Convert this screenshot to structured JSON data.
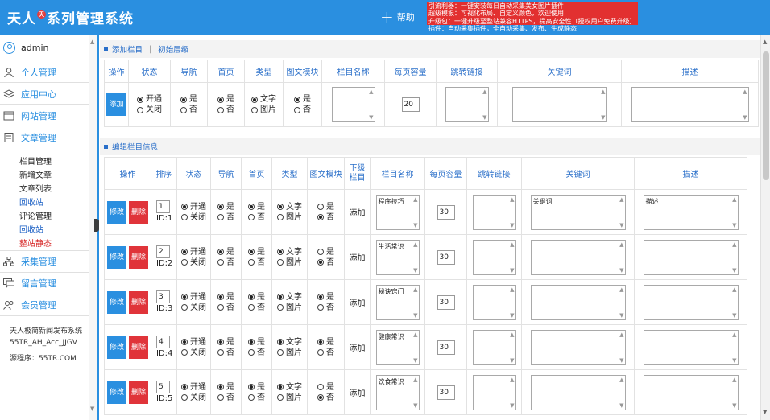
{
  "header": {
    "logo_a": "天人",
    "logo_mark": "天",
    "logo_b": "系列管理系统",
    "help_label": "帮助",
    "notices": [
      "引流利器：一键安装每日自动采集美女图片插件",
      "超级模板：可视化布局、自定义颜色，欢迎使用",
      "升级包：一键升级至整站兼容HTTPS，提高安全性（授权用户免费升级）",
      "插件：自动采集插件，全自动采集、发布、生成静态"
    ]
  },
  "sidebar": {
    "user": "admin",
    "menus": [
      {
        "label": "个人管理",
        "icon": "person-icon"
      },
      {
        "label": "应用中心",
        "icon": "layers-icon"
      },
      {
        "label": "网站管理",
        "icon": "website-icon"
      },
      {
        "label": "文章管理",
        "icon": "document-icon"
      }
    ],
    "subitems": [
      {
        "label": "栏目管理",
        "style": ""
      },
      {
        "label": "新增文章",
        "style": ""
      },
      {
        "label": "文章列表",
        "style": ""
      },
      {
        "label": "回收站",
        "style": "blue"
      },
      {
        "label": "评论管理",
        "style": ""
      },
      {
        "label": "回收站",
        "style": "blue"
      },
      {
        "label": "整站静态",
        "style": "red"
      }
    ],
    "menus2": [
      {
        "label": "采集管理",
        "icon": "network-icon"
      },
      {
        "label": "留言管理",
        "icon": "message-icon"
      },
      {
        "label": "会员管理",
        "icon": "members-icon"
      }
    ],
    "footer": [
      "天人极简新闻发布系统",
      "55TR_AH_Acc_JJGV",
      "源程序：55TR.COM"
    ]
  },
  "add_section": {
    "bar_label": "添加栏目",
    "bar_divider": "|",
    "bar_label2": "初始层级",
    "headers": [
      "操作",
      "状态",
      "导航",
      "首页",
      "类型",
      "图文模块",
      "栏目名称",
      "每页容量",
      "跳转链接",
      "关键词",
      "描述"
    ],
    "add_button": "添加",
    "status_opts": [
      "开通",
      "关闭"
    ],
    "yes": "是",
    "no": "否",
    "type_opts": [
      "文字",
      "图片"
    ],
    "page_size": "20"
  },
  "edit_section": {
    "bar_label": "编辑栏目信息",
    "headers": [
      "操作",
      "排序",
      "状态",
      "导航",
      "首页",
      "类型",
      "图文模块",
      "下级\n栏目",
      "栏目名称",
      "每页容量",
      "跳转链接",
      "关键词",
      "描述"
    ],
    "modify_label": "修改",
    "delete_label": "删除",
    "add_label": "添加",
    "id_prefix": "ID:",
    "rows": [
      {
        "sort": "1",
        "id": "1",
        "name": "程序技巧",
        "size": "30",
        "keywords": "关键词",
        "desc": "描述",
        "module_yes": false
      },
      {
        "sort": "2",
        "id": "2",
        "name": "生活常识",
        "size": "30",
        "keywords": "",
        "desc": "",
        "module_yes": false
      },
      {
        "sort": "3",
        "id": "3",
        "name": "秘诀窍门",
        "size": "30",
        "keywords": "",
        "desc": "",
        "module_yes": true
      },
      {
        "sort": "4",
        "id": "4",
        "name": "健康常识",
        "size": "30",
        "keywords": "",
        "desc": "",
        "module_yes": true
      },
      {
        "sort": "5",
        "id": "5",
        "name": "饮食常识",
        "size": "30",
        "keywords": "",
        "desc": "",
        "module_yes": false
      }
    ]
  },
  "colors": {
    "accent": "#2a8fe0",
    "danger": "#e0343a"
  }
}
